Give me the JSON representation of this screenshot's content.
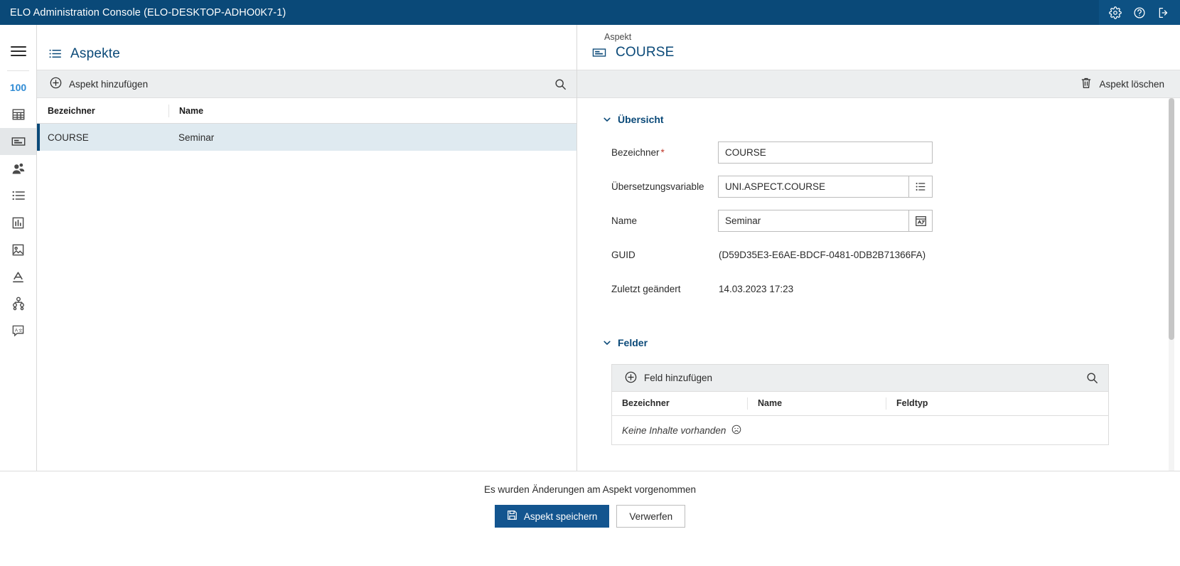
{
  "titlebar": {
    "title": "ELO Administration Console (ELO-DESKTOP-ADHO0K7-1)",
    "icons": [
      {
        "name": "settings-icon",
        "label": "Einstellungen"
      },
      {
        "name": "help-icon",
        "label": "Hilfe"
      },
      {
        "name": "logout-icon",
        "label": "Abmelden"
      }
    ]
  },
  "rail": {
    "menu_label": "Menü",
    "badge": "100",
    "items": [
      {
        "name": "table-icon",
        "label": "Tabellen"
      },
      {
        "name": "aspect-icon",
        "label": "Aspekte",
        "active": true
      },
      {
        "name": "users-icon",
        "label": "Benutzer"
      },
      {
        "name": "list-icon",
        "label": "Listen"
      },
      {
        "name": "report-icon",
        "label": "Berichte"
      },
      {
        "name": "image-icon",
        "label": "Masken"
      },
      {
        "name": "font-icon",
        "label": "Schriften"
      },
      {
        "name": "hierarchy-icon",
        "label": "Hierarchie"
      },
      {
        "name": "translation-icon",
        "label": "Übersetzungen"
      }
    ]
  },
  "list_panel": {
    "header_title": "Aspekte",
    "header_icon": "list-icon",
    "add_button": "Aspekt hinzufügen",
    "search_placeholder": "Suchen",
    "columns": [
      "Bezeichner",
      "Name"
    ],
    "rows": [
      {
        "bezeichner": "COURSE",
        "name": "Seminar",
        "selected": true
      }
    ]
  },
  "detail": {
    "breadcrumb": "Aspekt",
    "title": "COURSE",
    "title_icon": "aspect-icon",
    "delete_button": "Aspekt löschen",
    "sections": {
      "overview": {
        "heading": "Übersicht",
        "fields": {
          "bezeichner_label": "Bezeichner",
          "bezeichner_required": "*",
          "bezeichner_value": "COURSE",
          "uebersetzungsvariable_label": "Übersetzungsvariable",
          "uebersetzungsvariable_value": "UNI.ASPECT.COURSE",
          "uebersetzungsvariable_button": "list-picker-icon",
          "name_label": "Name",
          "name_value": "Seminar",
          "name_button": "translate-icon",
          "guid_label": "GUID",
          "guid_value": "(D59D35E3-E6AE-BDCF-0481-0DB2B71366FA)",
          "modified_label": "Zuletzt geändert",
          "modified_value": "14.03.2023 17:23"
        }
      },
      "fields": {
        "heading": "Felder",
        "add_button": "Feld hinzufügen",
        "columns": [
          "Bezeichner",
          "Name",
          "Feldtyp"
        ],
        "empty_text": "Keine Inhalte vorhanden",
        "empty_icon": "sad-face-icon",
        "rows": []
      }
    }
  },
  "bottom_bar": {
    "message": "Es wurden Änderungen am Aspekt vorgenommen",
    "save_label": "Aspekt speichern",
    "save_icon": "save-icon",
    "discard_label": "Verwerfen"
  },
  "colors": {
    "brand_dark": "#0a4978",
    "brand_title_bar": "#0a4978",
    "accent_blue": "#2f8bd4",
    "primary_button": "#13558f",
    "selected_row": "#dfeaf0",
    "toolbar_gray": "#eceeef",
    "required_red": "#c0392b"
  }
}
